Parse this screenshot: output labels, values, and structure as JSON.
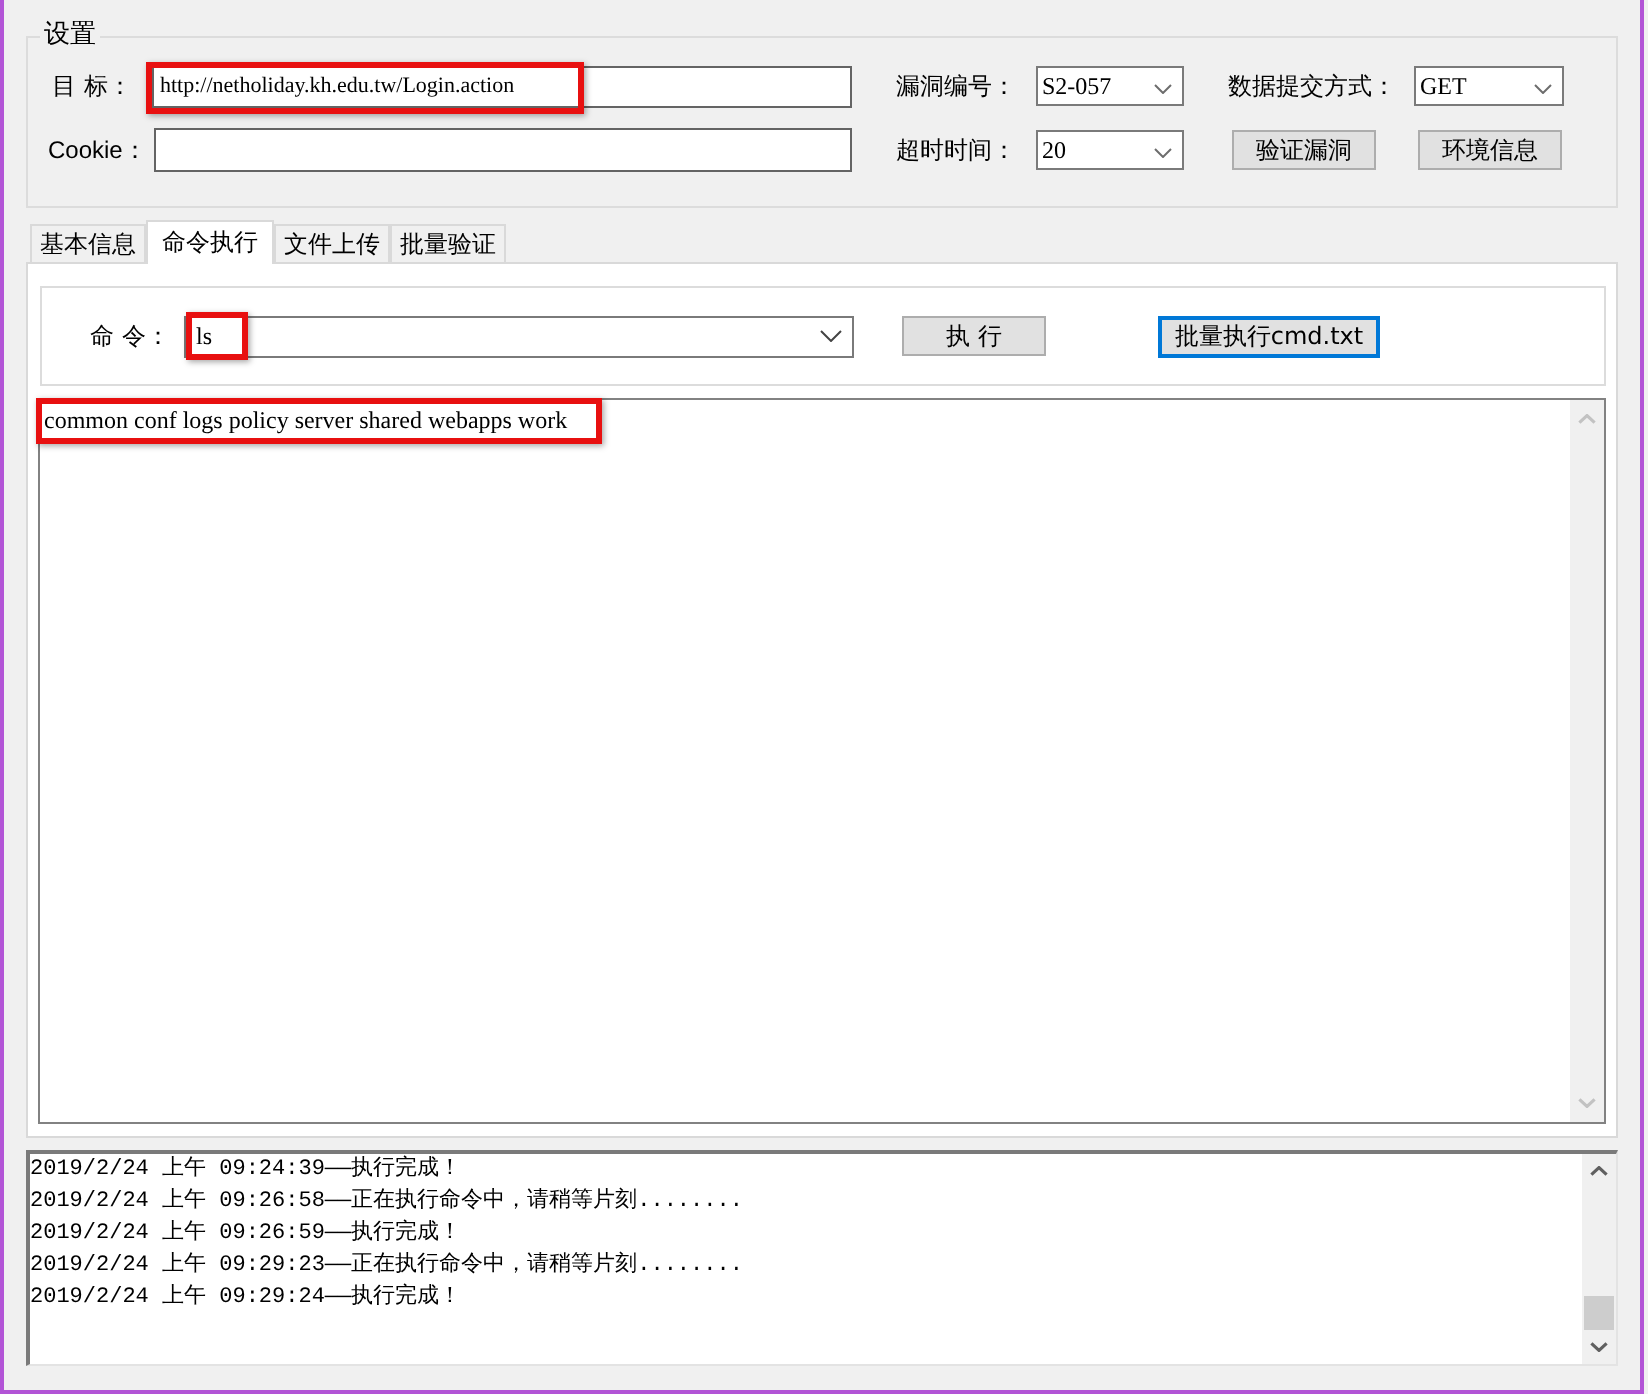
{
  "settings": {
    "title": "设置",
    "target": {
      "label": "目 标：",
      "value": "http://netholiday.kh.edu.tw/Login.action",
      "annotated": true
    },
    "vuln_id": {
      "label": "漏洞编号：",
      "value": "S2-057"
    },
    "method": {
      "label": "数据提交方式：",
      "value": "GET"
    },
    "cookie": {
      "label": "Cookie："
    },
    "timeout": {
      "label": "超时时间：",
      "value": "20"
    },
    "buttons": [
      {
        "label": "验证漏洞",
        "focused": false
      },
      {
        "label": "环境信息",
        "focused": false
      }
    ]
  },
  "tabs": [
    {
      "label": "基本信息",
      "selected": false
    },
    {
      "label": "命令执行",
      "selected": true
    },
    {
      "label": "文件上传",
      "selected": false
    },
    {
      "label": "批量验证",
      "selected": false
    }
  ],
  "command": {
    "label": "命 令：",
    "value": "ls",
    "annotated": true,
    "buttons": [
      {
        "label": "执 行",
        "focused": false
      },
      {
        "label": "批量执行cmd.txt",
        "focused": true
      }
    ]
  },
  "output": {
    "text": "common conf logs policy server shared webapps work",
    "annotated": true
  },
  "log": {
    "lines": [
      "2019/2/24 上午 09:24:39——执行完成！",
      "2019/2/24 上午 09:26:58——正在执行命令中，请稍等片刻........",
      "2019/2/24 上午 09:26:59——执行完成！",
      "2019/2/24 上午 09:29:23——正在执行命令中，请稍等片刻........",
      "2019/2/24 上午 09:29:24——执行完成！"
    ]
  }
}
